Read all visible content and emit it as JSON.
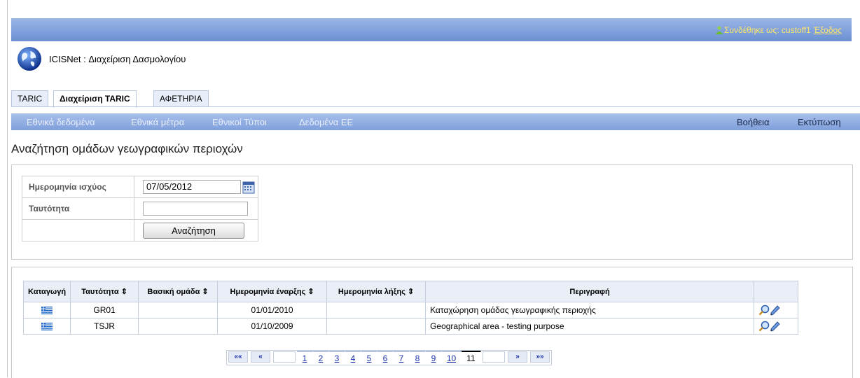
{
  "header": {
    "login_text": "Συνδέθηκε ως: custoff1",
    "logout_label": "Έξοδος",
    "app_title": "ICISNet : Διαχείριση Δασμολογίου"
  },
  "tabs": [
    {
      "label": "TARIC"
    },
    {
      "label": "Διαχείριση TARIC"
    },
    {
      "label": "ΑΦΕΤΗΡΙΑ"
    }
  ],
  "menu": {
    "items": [
      "Εθνικά δεδομένα",
      "Εθνικά μέτρα",
      "Εθνικοί Τύποι",
      "Δεδομένα ΕΕ"
    ],
    "right": [
      "Βοήθεια",
      "Εκτύπωση"
    ]
  },
  "page_title": "Αναζήτηση ομάδων γεωγραφικών περιοχών",
  "search": {
    "date_label": "Ημερομηνία ισχύος",
    "date_value": "07/05/2012",
    "id_label": "Ταυτότητα",
    "id_value": "",
    "button_label": "Αναζήτηση"
  },
  "table": {
    "headers": [
      "Καταγωγή",
      "Ταυτότητα ⇕",
      "Βασική ομάδα ⇕",
      "Ημερομηνία έναρξης ⇕",
      "Ημερομηνία λήξης ⇕",
      "Περιγραφή",
      ""
    ],
    "rows": [
      {
        "id": "GR01",
        "base": "",
        "start": "01/01/2010",
        "end": "",
        "desc": "Καταχώρηση ομάδας γεωγραφικής περιοχής"
      },
      {
        "id": "TSJR",
        "base": "",
        "start": "01/10/2009",
        "end": "",
        "desc": "Geographical area - testing purpose"
      }
    ]
  },
  "pager": {
    "first": "««",
    "prev": "«",
    "pages": [
      "1",
      "2",
      "3",
      "4",
      "5",
      "6",
      "7",
      "8",
      "9",
      "10"
    ],
    "current": "11",
    "next": "»",
    "last": "»»"
  },
  "colors": {
    "topbar": "#7f9fdc",
    "login_text": "#ffe66a",
    "link": "#1a2fa8"
  }
}
